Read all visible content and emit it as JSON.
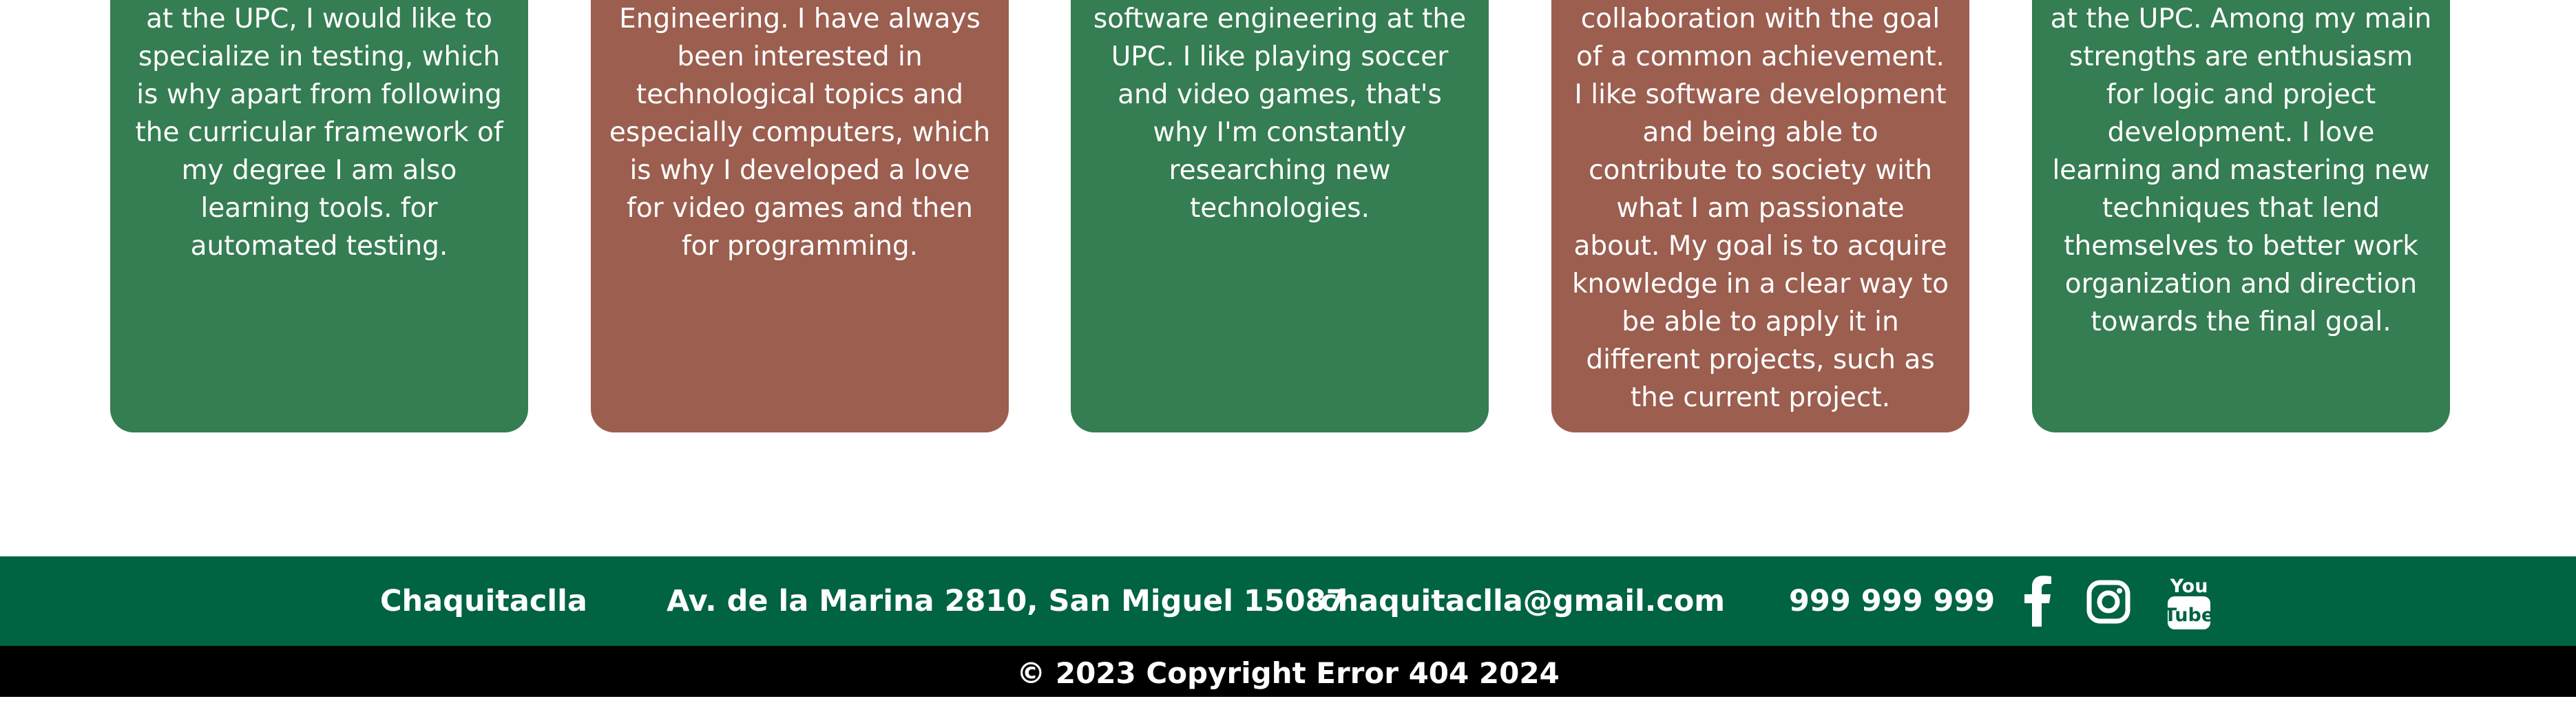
{
  "cards": [
    {
      "text": "at the UPC, I would like to specialize in testing, which is why apart from following the curricular framework of my degree I am also learning tools. for automated testing."
    },
    {
      "text": "Engineering. I have always been interested in technological topics and especially computers, which is why I developed a love for video games and then for programming."
    },
    {
      "text": "software engineering at the UPC. I like playing soccer and video games, that's why I'm constantly researching new technologies."
    },
    {
      "text": "collaboration with the goal of a common achievement. I like software development and being able to contribute to society with what I am passionate about. My goal is to acquire knowledge in a clear way to be able to apply it in different projects, such as the current project."
    },
    {
      "text": "at the UPC. Among my main strengths are enthusiasm for logic and project development. I love learning and mastering new techniques that lend themselves to better work organization and direction towards the final goal."
    }
  ],
  "footer": {
    "brand": "Chaquitaclla",
    "address": "Av. de la Marina 2810, San Miguel 15087",
    "email": "chaquitaclla@gmail.com",
    "phone": "999 999 999",
    "social_icons": [
      "facebook-icon",
      "instagram-icon",
      "youtube-icon"
    ],
    "youtube_icon_text": {
      "line1": "You",
      "line2": "Tube"
    }
  },
  "copyright": "© 2023 Copyright Error 404 2024",
  "colors": {
    "card_green": "#357d52",
    "card_brown": "#9b5e4f",
    "footer_bg": "#006341",
    "copyright_bg": "#000000"
  }
}
